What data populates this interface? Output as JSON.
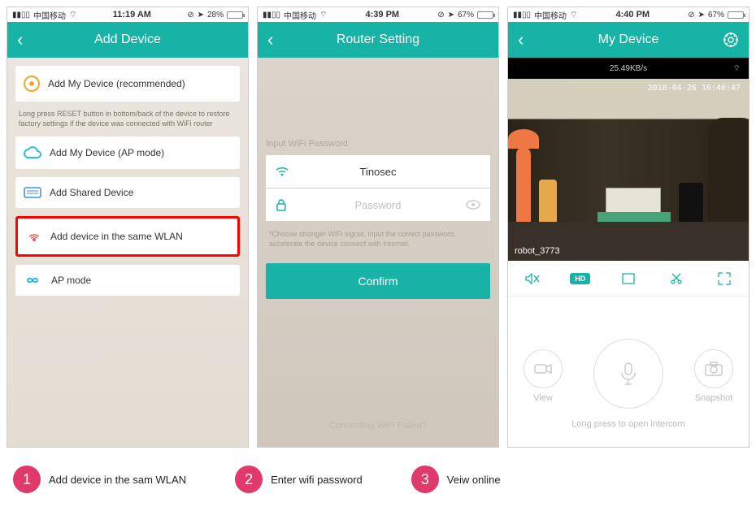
{
  "screen1": {
    "status": {
      "carrier": "中国移动",
      "time": "11:19 AM",
      "batt": "28%",
      "batt_fill": "28%"
    },
    "title": "Add Device",
    "opt_recommended": "Add My Device (recommended)",
    "hint_reset": "Long press RESET button in bottom/back of the device to restore factory settings if the device was connected with WiFi router",
    "opt_ap": "Add My Device (AP mode)",
    "opt_shared": "Add Shared Device",
    "opt_wlan": "Add device in the same WLAN",
    "opt_apmode": "AP mode"
  },
  "screen2": {
    "status": {
      "carrier": "中国移动",
      "time": "4:39 PM",
      "batt": "67%",
      "batt_fill": "67%"
    },
    "title": "Router Setting",
    "input_label": "Input WiFi Password",
    "ssid": "Tinosec",
    "pwd_placeholder": "Password",
    "choose_hint": "*Choose stronger WiFi signal, input the correct password, accelerate the device connect with Internet.",
    "confirm": "Confirm",
    "fail": "Connecting WiFi Failed?"
  },
  "screen3": {
    "status": {
      "carrier": "中国移动",
      "time": "4:40 PM",
      "batt": "67%",
      "batt_fill": "67%"
    },
    "title": "My Device",
    "speed": "25.49KB/s",
    "timestamp": "2018-04-26 16:40:47",
    "device_name": "robot_3773",
    "hd": "HD",
    "view": "View",
    "snapshot": "Snapshot",
    "longpress": "Long press to open intercom"
  },
  "steps": {
    "s1": "Add device in the sam WLAN",
    "s2": "Enter wifi password",
    "s3": "Veiw online"
  }
}
